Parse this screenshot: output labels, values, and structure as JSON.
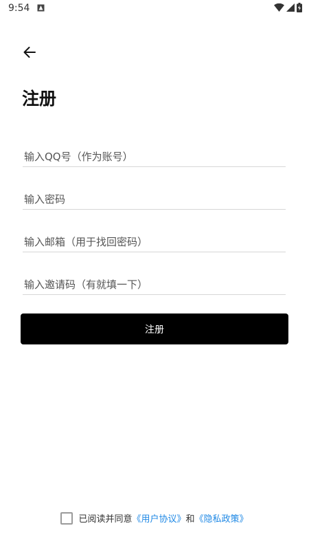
{
  "status_bar": {
    "time": "9:54"
  },
  "header": {
    "title": "注册"
  },
  "form": {
    "qq_placeholder": "输入QQ号（作为账号）",
    "password_placeholder": "输入密码",
    "email_placeholder": "输入邮箱（用于找回密码）",
    "invite_placeholder": "输入邀请码（有就填一下）",
    "submit_label": "注册"
  },
  "agreement": {
    "prefix": "已阅读并同意",
    "user_agreement": "《用户协议》",
    "and": "和",
    "privacy_policy": "《隐私政策》"
  },
  "colors": {
    "link": "#1e88e5",
    "button": "#000000"
  }
}
